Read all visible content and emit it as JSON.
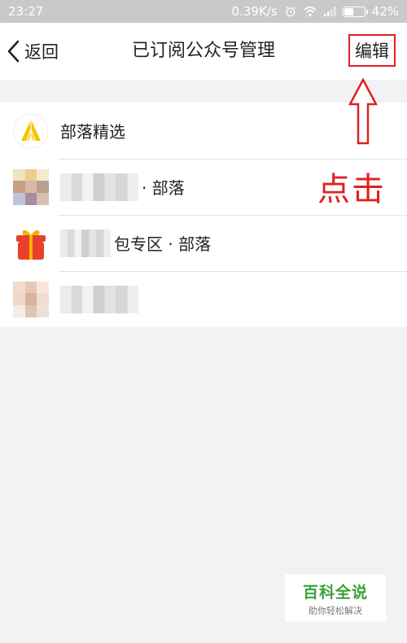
{
  "status_bar": {
    "time": "23:27",
    "network_speed": "0.39K/s",
    "battery_percent": "42%",
    "icons": [
      "alarm-icon",
      "wifi-icon",
      "signal-icon",
      "battery-icon"
    ]
  },
  "nav": {
    "back_label": "返回",
    "title": "已订阅公众号管理",
    "edit_label": "编辑"
  },
  "subscriptions": [
    {
      "label": "部落精选",
      "avatar": "tent-icon",
      "blurred_prefix": false
    },
    {
      "label": "· 部落",
      "avatar": "mosaic-avatar",
      "blurred_prefix": true
    },
    {
      "label": "包专区 · 部落",
      "avatar": "gift-icon",
      "blurred_prefix": true
    },
    {
      "label": "",
      "avatar": "mosaic-avatar",
      "blurred_prefix": true
    }
  ],
  "annotation": {
    "text": "点击",
    "color": "#e02020"
  },
  "watermark": {
    "main": "百科全说",
    "sub": "助你轻松解决"
  },
  "colors": {
    "accent_red": "#e02020",
    "background": "#f2f2f4",
    "status_bar": "#c9c9c9"
  }
}
